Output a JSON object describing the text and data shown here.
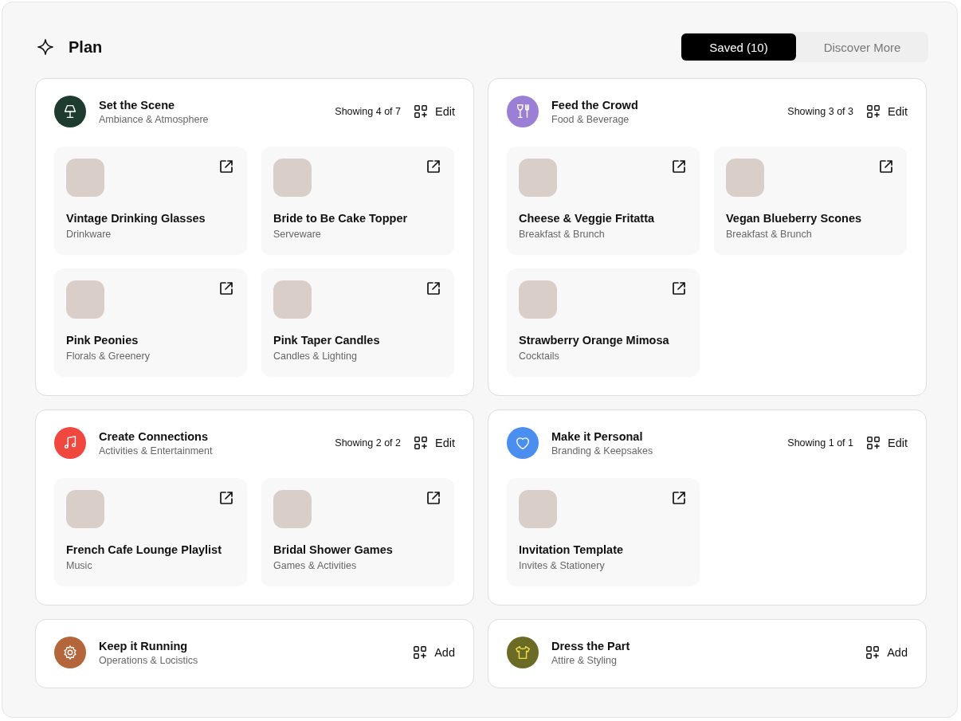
{
  "header": {
    "title": "Plan"
  },
  "tabs": [
    {
      "label": "Saved  (10)",
      "selected": true
    },
    {
      "label": "Discover More",
      "selected": false
    }
  ],
  "sections": [
    {
      "kind": "lamp",
      "color": "#1f3b30",
      "title": "Set the Scene",
      "subtitle": "Ambiance & Atmosphere",
      "showing": "Showing 4 of 7",
      "action": "Edit",
      "items": [
        {
          "title": "Vintage Drinking Glasses",
          "category": "Drinkware"
        },
        {
          "title": "Bride to Be Cake Topper",
          "category": "Serveware"
        },
        {
          "title": "Pink Peonies",
          "category": "Florals & Greenery"
        },
        {
          "title": "Pink Taper Candles",
          "category": "Candles & Lighting"
        }
      ]
    },
    {
      "kind": "dining",
      "color": "#9b7fd6",
      "title": "Feed the Crowd",
      "subtitle": "Food & Beverage",
      "showing": "Showing 3 of 3",
      "action": "Edit",
      "items": [
        {
          "title": "Cheese & Veggie Fritatta",
          "category": "Breakfast & Brunch"
        },
        {
          "title": "Vegan Blueberry Scones",
          "category": "Breakfast & Brunch"
        },
        {
          "title": "Strawberry Orange Mimosa",
          "category": "Cocktails"
        }
      ]
    },
    {
      "kind": "music",
      "color": "#f0473f",
      "title": "Create Connections",
      "subtitle": "Activities & Entertainment",
      "showing": "Showing 2 of 2",
      "action": "Edit",
      "items": [
        {
          "title": "French Cafe Lounge Playlist",
          "category": "Music"
        },
        {
          "title": "Bridal Shower Games",
          "category": "Games & Activities"
        }
      ]
    },
    {
      "kind": "heart",
      "color": "#4a8ff0",
      "title": "Make it Personal",
      "subtitle": "Branding & Keepsakes",
      "showing": "Showing 1 of 1",
      "action": "Edit",
      "items": [
        {
          "title": "Invitation Template",
          "category": "Invites & Stationery"
        }
      ]
    },
    {
      "kind": "gear",
      "color": "#b5653a",
      "title": "Keep it Running",
      "subtitle": "Operations & Locistics",
      "action": "Add"
    },
    {
      "kind": "shirt",
      "color": "#6b6b26",
      "title": "Dress the Part",
      "subtitle": "Attire & Styling",
      "action": "Add"
    }
  ]
}
